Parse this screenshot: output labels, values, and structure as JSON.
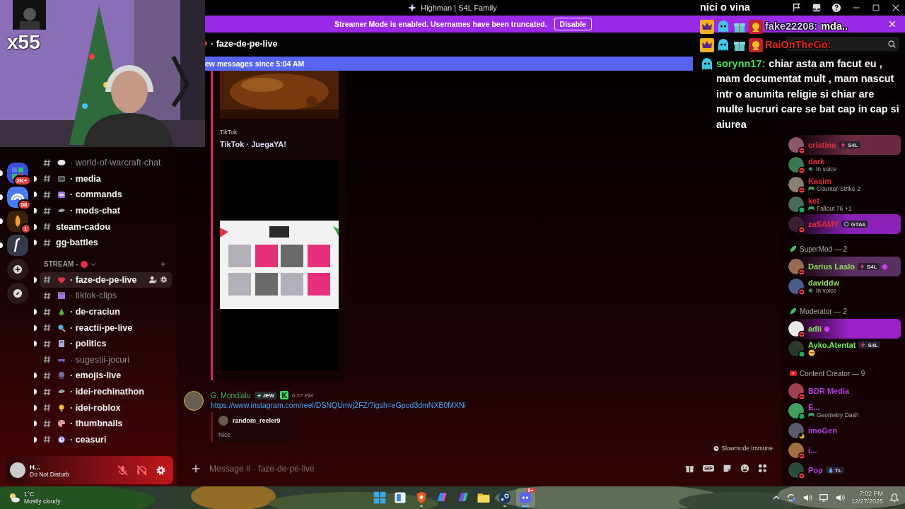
{
  "window": {
    "title": "Highman | S4L Family"
  },
  "streamer_banner": {
    "text": "Streamer Mode is enabled. Usernames have been truncated.",
    "button": "Disable"
  },
  "webcam": {
    "kind": "picture",
    "counter": "x55"
  },
  "stream_chat": [
    {
      "text": "nici o vina"
    },
    {
      "user": "fake22208:",
      "color": "#d8c8ff",
      "text": "mda.."
    },
    {
      "user": "RaiOnTheGo:",
      "color": "#e02a1a"
    },
    {
      "user": "sorynn17:",
      "color": "#4ae05a",
      "text": "chiar asta am facut eu , mam documentat mult , mam nascut intr o anumita religie si chiar are multe lucruri care se bat cap in cap si aiurea"
    }
  ],
  "servers": [
    {
      "kind": "server",
      "color": "#3b4fd8",
      "badge": "2K+",
      "unread": true
    },
    {
      "kind": "server",
      "color": "#4a7cf0",
      "badge": "58",
      "unread": true
    },
    {
      "kind": "server",
      "color": "#3a2208",
      "badge": "1",
      "unread": true
    },
    {
      "kind": "server",
      "color": "#353a48",
      "unread": true
    },
    {
      "kind": "add"
    },
    {
      "kind": "discover"
    }
  ],
  "channel_list": [
    {
      "kind": "channel",
      "name": "· world-of-warcraft-chat",
      "unread": false,
      "selected": false
    },
    {
      "kind": "channel",
      "name": "· media",
      "unread": true,
      "selected": false
    },
    {
      "kind": "channel",
      "name": "· commands",
      "unread": true,
      "selected": false
    },
    {
      "kind": "channel",
      "name": "· mods-chat",
      "unread": true,
      "selected": false
    },
    {
      "kind": "channel",
      "name": "steam-cadou",
      "unread": true,
      "selected": false
    },
    {
      "kind": "channel",
      "name": "gg-battles",
      "unread": true,
      "selected": false
    },
    {
      "kind": "category",
      "name": "STREAM -"
    },
    {
      "kind": "channel",
      "name": "· faze-de-pe-live",
      "unread": true,
      "selected": true
    },
    {
      "kind": "channel",
      "name": "· tiktok-clips",
      "unread": false,
      "selected": false
    },
    {
      "kind": "channel",
      "name": "· de-craciun",
      "unread": true,
      "selected": false
    },
    {
      "kind": "channel",
      "name": "· reactii-pe-live",
      "unread": true,
      "selected": false
    },
    {
      "kind": "channel",
      "name": "· politics",
      "unread": true,
      "selected": false
    },
    {
      "kind": "channel",
      "name": "· sugestii-jocuri",
      "unread": false,
      "selected": false
    },
    {
      "kind": "channel",
      "name": "· emojis-live",
      "unread": true,
      "selected": false
    },
    {
      "kind": "channel",
      "name": "· idei-rechinathon",
      "unread": true,
      "selected": false
    },
    {
      "kind": "channel",
      "name": "· idei-roblox",
      "unread": true,
      "selected": false
    },
    {
      "kind": "channel",
      "name": "· thumbnails",
      "unread": true,
      "selected": false
    },
    {
      "kind": "channel",
      "name": "· ceasuri",
      "unread": true,
      "selected": false
    }
  ],
  "user_panel": {
    "name": "H...",
    "status": "Do Not Disturb",
    "mic_muted": true,
    "deafened": true
  },
  "chat_header": {
    "channel": "· faze-de-pe-live"
  },
  "new_messages": "ew messages since 5:04 AM",
  "embed": {
    "provider": "TikTok",
    "title": "TikTok · JuegaYA!"
  },
  "message": {
    "author": "G. Mondialu",
    "color": "#3fae5e",
    "tag": "JEW",
    "time": "6:27 PM",
    "link": "https://www.instagram.com/reel/DSNQUmvj2FZ/?igsh=eGpod3dmNXB0MXNi",
    "embed": {
      "author": "random_reeler9",
      "text": "Nice"
    }
  },
  "slowmode": "Slowmode Immune",
  "composer": {
    "placeholder": "Message # · faze-de-pe-live",
    "gif": "GIF"
  },
  "members": [
    {
      "kind": "member",
      "name": "cristina",
      "color": "#e0303a",
      "presence": {
        "kind": "dnd"
      },
      "tag": {
        "label": "S4L",
        "kind": "bolt"
      },
      "nameplate": {
        "color": "#6a2a44"
      }
    },
    {
      "kind": "member",
      "name": "dark",
      "color": "#e0303a",
      "presence": {
        "kind": "dnd"
      },
      "activity": {
        "kind": "voice",
        "text": "In voice"
      }
    },
    {
      "kind": "member",
      "name": "Kasim",
      "color": "#e0303a",
      "presence": {
        "kind": "dnd"
      },
      "activity": {
        "kind": "game",
        "text": "Counter-Strike 2"
      }
    },
    {
      "kind": "member",
      "name": "ket",
      "color": "#e0303a",
      "presence": {
        "kind": "online"
      },
      "activity": {
        "kind": "game",
        "text": "Fallout 76 +1"
      }
    },
    {
      "kind": "member",
      "name": "zaSAMY",
      "color": "#e0303a",
      "presence": {
        "kind": "dnd"
      },
      "tag": {
        "label": "GTA6",
        "kind": "ring"
      },
      "nameplate": {
        "color": "#8a22b8"
      }
    },
    {
      "kind": "header",
      "text": "SuperMod — 2"
    },
    {
      "kind": "member",
      "name": "Darius Laslo",
      "color": "#90e060",
      "presence": {
        "kind": "dnd"
      },
      "tag": {
        "label": "S4L",
        "kind": "bolt"
      },
      "boost": true,
      "nameplate": {
        "color": "#5a3060"
      }
    },
    {
      "kind": "member",
      "name": "daviddw",
      "color": "#90e060",
      "presence": {
        "kind": "dnd"
      },
      "activity": {
        "kind": "voice",
        "text": "In voice"
      }
    },
    {
      "kind": "header",
      "text": "Moderator — 2"
    },
    {
      "kind": "member",
      "name": "adii",
      "color": "#90e060",
      "presence": {
        "kind": "dnd"
      },
      "boost": true,
      "nameplate": {
        "color": "#9a20c8"
      }
    },
    {
      "kind": "member",
      "name": "Ayko.Atentat",
      "color": "#70f050",
      "presence": {
        "kind": "online"
      },
      "tag": {
        "label": "S4L",
        "kind": "bolt"
      },
      "activity": {
        "kind": "emoji"
      }
    },
    {
      "kind": "header",
      "text": "Content Creator — 9"
    },
    {
      "kind": "member",
      "name": "BDR Media",
      "color": "#b040e0",
      "presence": {
        "kind": "dnd"
      }
    },
    {
      "kind": "member",
      "name": "E...",
      "color": "#b040e0",
      "presence": {
        "kind": "online"
      },
      "activity": {
        "kind": "game",
        "text": "Geometry Dash"
      }
    },
    {
      "kind": "member",
      "name": "imoGen",
      "color": "#b040e0",
      "presence": {
        "kind": "idle"
      }
    },
    {
      "kind": "member",
      "name": "i...",
      "color": "#b040e0",
      "presence": {
        "kind": "dnd"
      }
    },
    {
      "kind": "member",
      "name": "Pop",
      "color": "#b040e0",
      "presence": {
        "kind": "dnd"
      },
      "tag": {
        "label": "TL",
        "kind": "drop"
      }
    }
  ],
  "taskbar": {
    "weather": {
      "temp": "1°C",
      "text": "Mostly cloudy"
    },
    "apps": [
      {
        "kind": "start",
        "running": false,
        "selected": false
      },
      {
        "kind": "widgets",
        "running": false,
        "selected": false
      },
      {
        "kind": "browser",
        "running": true,
        "selected": false
      },
      {
        "kind": "copilot",
        "running": false,
        "selected": false
      },
      {
        "kind": "office",
        "running": false,
        "selected": false
      },
      {
        "kind": "folder",
        "running": false,
        "selected": false
      },
      {
        "kind": "steam",
        "running": true,
        "selected": false
      },
      {
        "kind": "discord",
        "running": true,
        "selected": true,
        "badge": "9+"
      }
    ],
    "time": "7:02 PM",
    "date": "12/27/2025"
  }
}
